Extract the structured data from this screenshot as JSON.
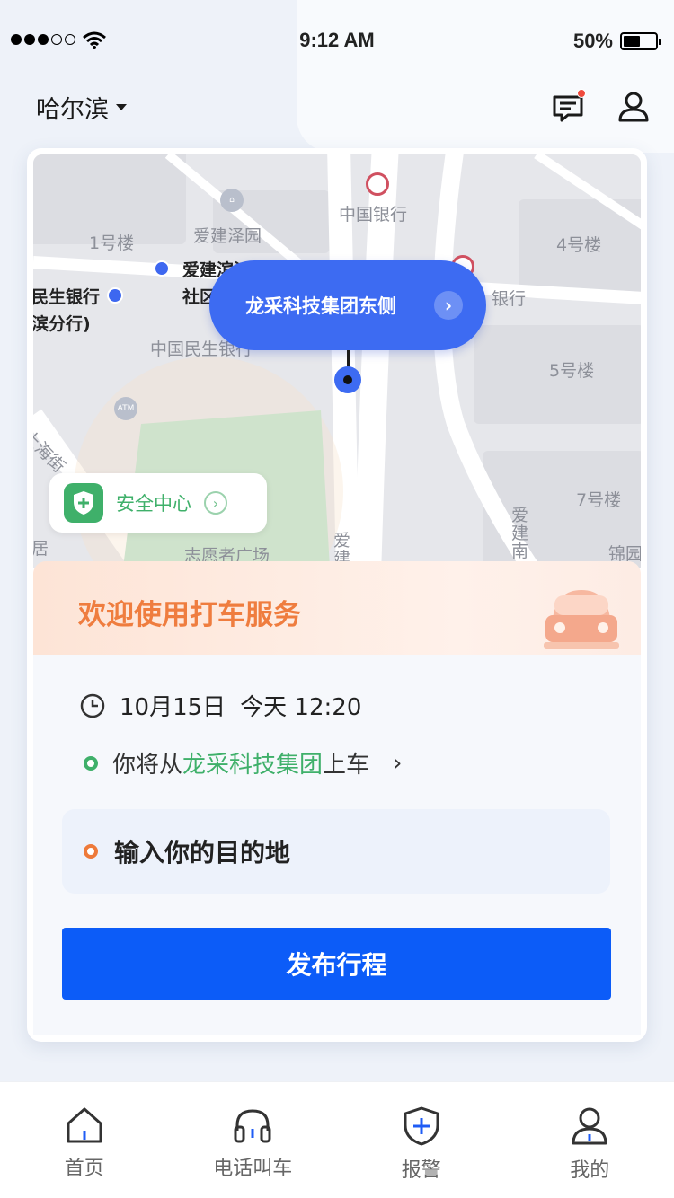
{
  "status_bar": {
    "time": "9:12 AM",
    "battery": "50%"
  },
  "header": {
    "city": "哈尔滨"
  },
  "map": {
    "labels": [
      {
        "text": "中国银行",
        "name": "map-label-china-bank"
      },
      {
        "text": "爱建泽园",
        "name": "map-label-aijian-zeyuan"
      },
      {
        "text": "1号楼",
        "name": "map-label-building-1"
      },
      {
        "text": "4号楼",
        "name": "map-label-building-4"
      },
      {
        "text": "爱建滨江国际",
        "name": "map-label-aijian-binjiang"
      },
      {
        "text": "社区",
        "name": "map-label-community"
      },
      {
        "text": "民生银行",
        "name": "map-label-minsheng-bank-left"
      },
      {
        "text": "滨分行)",
        "name": "map-label-branch"
      },
      {
        "text": "银行",
        "name": "map-label-bank-right"
      },
      {
        "text": "中国民生银行",
        "name": "map-label-minsheng-bank"
      },
      {
        "text": "5号楼",
        "name": "map-label-building-5"
      },
      {
        "text": "7号楼",
        "name": "map-label-building-7"
      },
      {
        "text": "志愿者广场",
        "name": "map-label-volunteer-square"
      },
      {
        "text": "居",
        "name": "map-label-ju"
      },
      {
        "text": "锦园",
        "name": "map-label-jinyuan"
      }
    ],
    "street_left": "上海街",
    "street_mid": "爱建",
    "street_right": "爱建南",
    "atm": "ATM",
    "pickup_point": "龙采科技集团东侧",
    "safety_center": "安全中心"
  },
  "welcome": {
    "title": "欢迎使用打车服务"
  },
  "trip": {
    "date": "10月15日",
    "day_time": "今天 12:20",
    "from_prefix": "你将从",
    "from_place": "龙采科技集团",
    "from_suffix": "上车",
    "destination_placeholder": "输入你的目的地",
    "publish_label": "发布行程"
  },
  "tabs": [
    {
      "label": "首页",
      "icon": "home-icon"
    },
    {
      "label": "电话叫车",
      "icon": "headset-icon"
    },
    {
      "label": "报警",
      "icon": "shield-plus-icon"
    },
    {
      "label": "我的",
      "icon": "profile-icon"
    }
  ],
  "colors": {
    "accent_blue": "#0c5cf8",
    "pin_blue": "#3d6bf2",
    "green": "#3fb06a",
    "orange": "#ef7d3f"
  }
}
